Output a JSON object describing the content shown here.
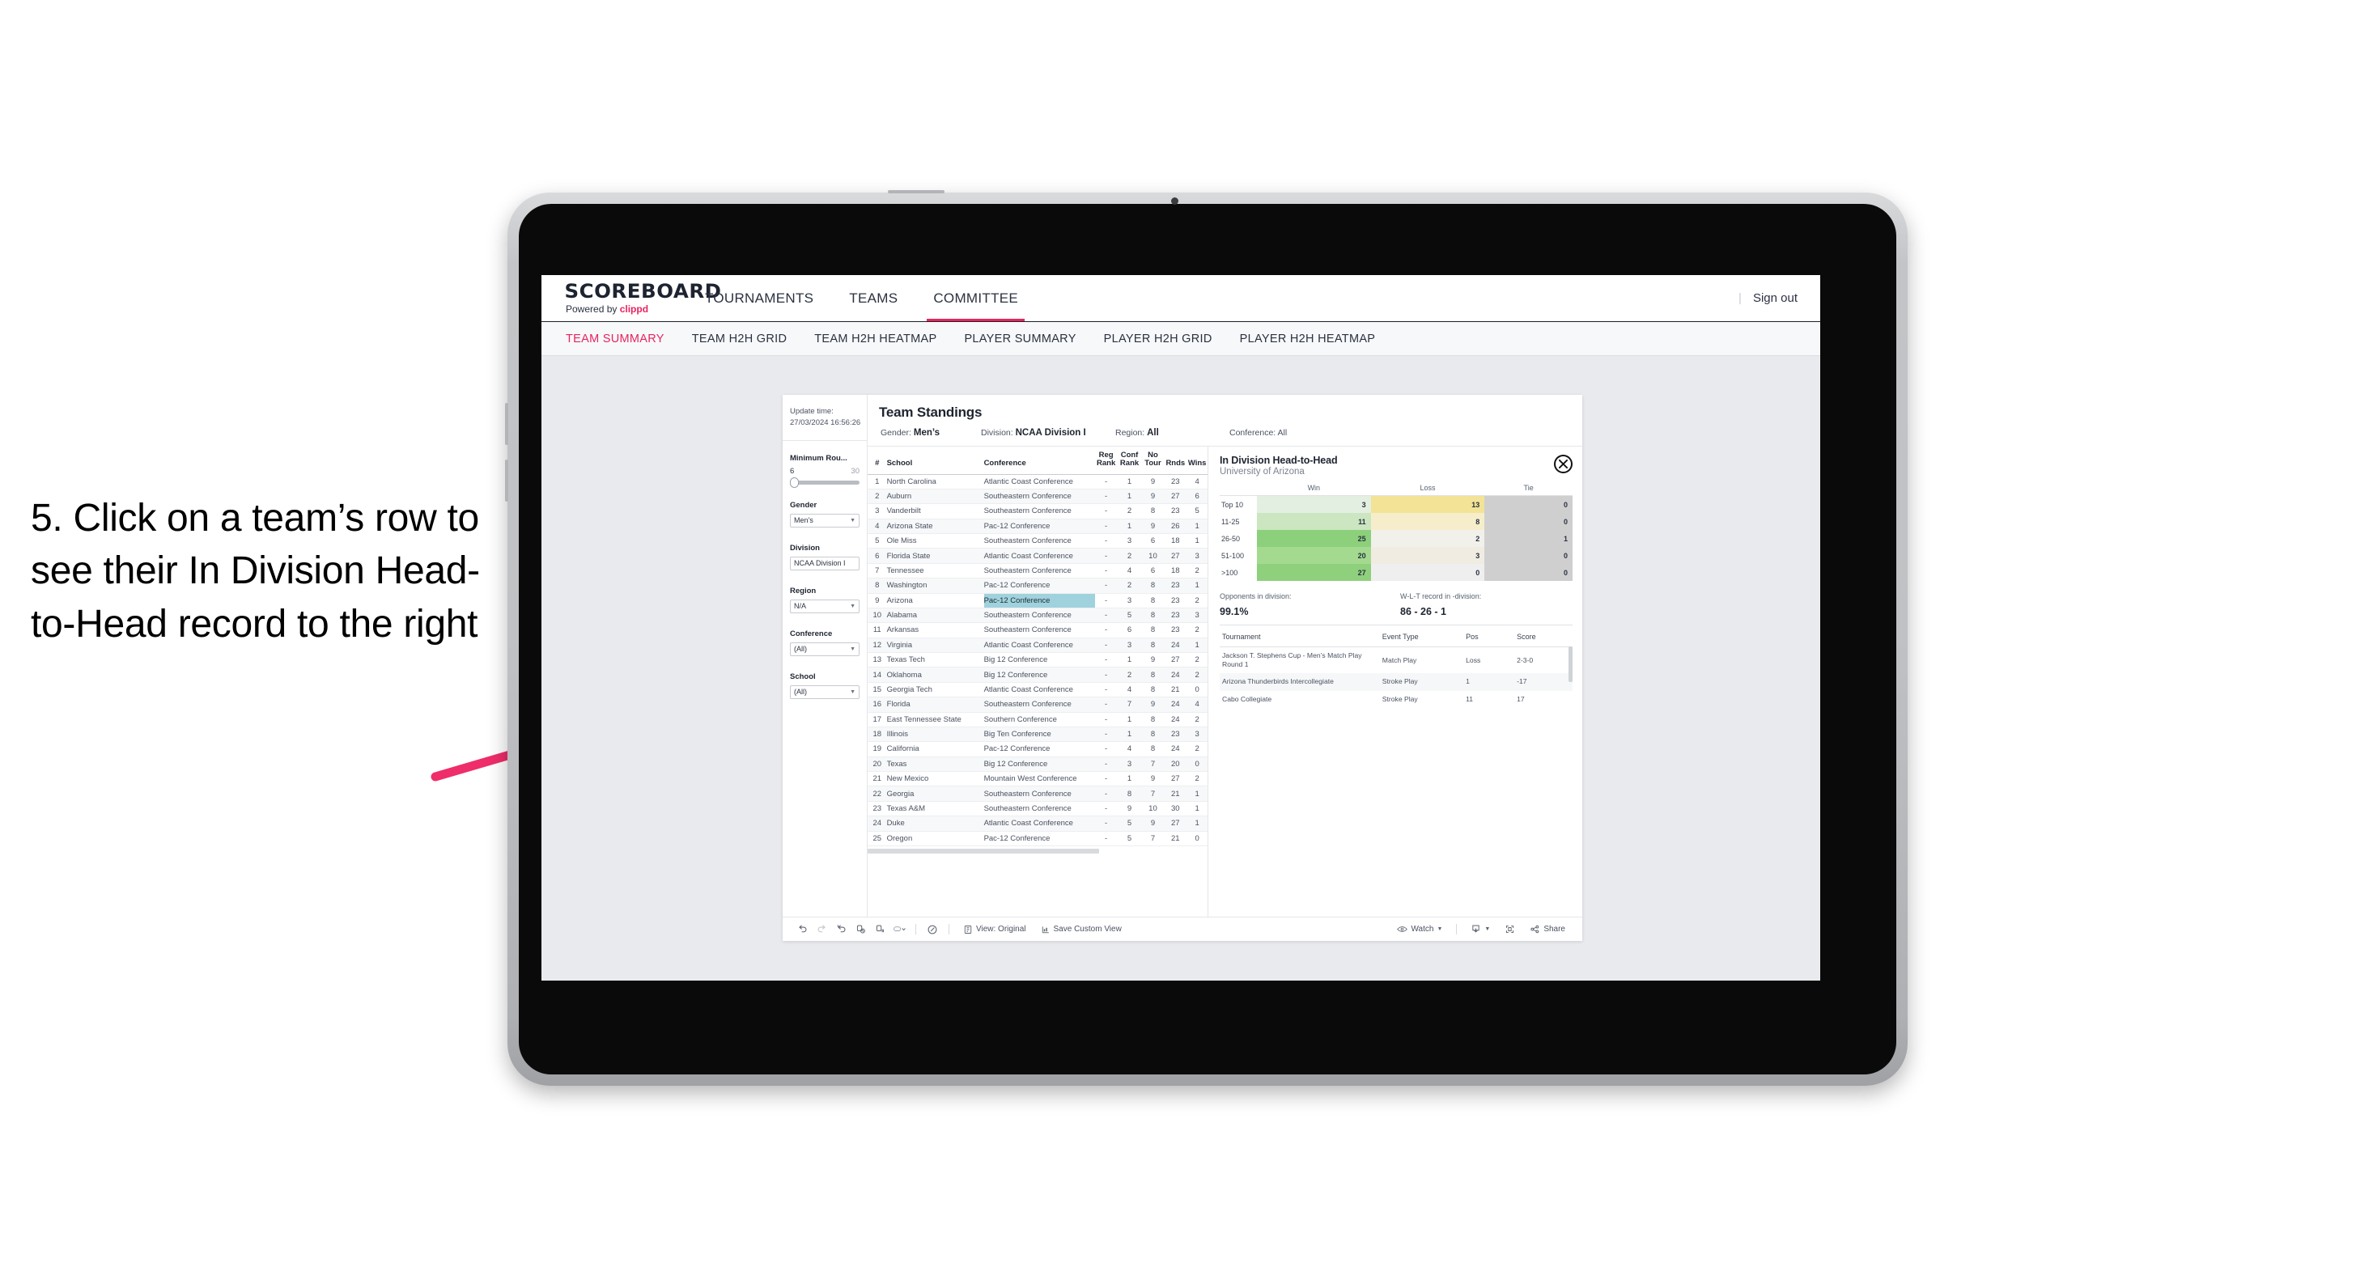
{
  "annotation": {
    "text": "5. Click on a team’s row to see their In Division Head-to-Head record to the right",
    "arrow_color": "#ef2d6a"
  },
  "app": {
    "logo": {
      "main": "SCOREBOARD",
      "powered_prefix": "Powered by ",
      "brand": "clippd"
    },
    "top_nav": [
      {
        "label": "TOURNAMENTS",
        "active": false
      },
      {
        "label": "TEAMS",
        "active": false
      },
      {
        "label": "COMMITTEE",
        "active": true
      }
    ],
    "sign_out": "Sign out",
    "sub_tabs": [
      {
        "label": "TEAM SUMMARY",
        "active": true
      },
      {
        "label": "TEAM H2H GRID",
        "active": false
      },
      {
        "label": "TEAM H2H HEATMAP",
        "active": false
      },
      {
        "label": "PLAYER SUMMARY",
        "active": false
      },
      {
        "label": "PLAYER H2H GRID",
        "active": false
      },
      {
        "label": "PLAYER H2H HEATMAP",
        "active": false
      }
    ],
    "accent_color": "#e8245e"
  },
  "filters": {
    "update_time_label": "Update time:",
    "update_time_value": "27/03/2024 16:56:26",
    "min_rounds": {
      "label": "Minimum Rou...",
      "low": "6",
      "high": "30"
    },
    "groups": [
      {
        "label": "Gender",
        "value": "Men’s"
      },
      {
        "label": "Division",
        "value": "NCAA Division I"
      },
      {
        "label": "Region",
        "value": "N/A"
      },
      {
        "label": "Conference",
        "value": "(All)"
      },
      {
        "label": "School",
        "value": "(All)"
      }
    ]
  },
  "standings": {
    "title": "Team Standings",
    "breadcrumbs": [
      {
        "key": "Gender: ",
        "value": "Men’s"
      },
      {
        "key": "Division: ",
        "value": "NCAA Division I"
      },
      {
        "key": "Region: ",
        "value": "All"
      },
      {
        "key": "Conference: ",
        "value": "All"
      }
    ],
    "columns": [
      "#",
      "School",
      "Conference",
      "Reg Rank",
      "Conf Rank",
      "No Tour",
      "Rnds",
      "Wins"
    ],
    "column_lines": [
      [
        "#"
      ],
      [
        "School"
      ],
      [
        "Conference"
      ],
      [
        "Reg",
        "Rank"
      ],
      [
        "Conf",
        "Rank"
      ],
      [
        "No",
        "Tour"
      ],
      [
        "Rnds"
      ],
      [
        "Wins"
      ]
    ],
    "selected_row_index": 8,
    "rows": [
      {
        "rank": "1",
        "school": "North Carolina",
        "conference": "Atlantic Coast Conference",
        "reg": "-",
        "conf": "1",
        "notour": "9",
        "rnds": "23",
        "wins": "4"
      },
      {
        "rank": "2",
        "school": "Auburn",
        "conference": "Southeastern Conference",
        "reg": "-",
        "conf": "1",
        "notour": "9",
        "rnds": "27",
        "wins": "6"
      },
      {
        "rank": "3",
        "school": "Vanderbilt",
        "conference": "Southeastern Conference",
        "reg": "-",
        "conf": "2",
        "notour": "8",
        "rnds": "23",
        "wins": "5"
      },
      {
        "rank": "4",
        "school": "Arizona State",
        "conference": "Pac-12 Conference",
        "reg": "-",
        "conf": "1",
        "notour": "9",
        "rnds": "26",
        "wins": "1"
      },
      {
        "rank": "5",
        "school": "Ole Miss",
        "conference": "Southeastern Conference",
        "reg": "-",
        "conf": "3",
        "notour": "6",
        "rnds": "18",
        "wins": "1"
      },
      {
        "rank": "6",
        "school": "Florida State",
        "conference": "Atlantic Coast Conference",
        "reg": "-",
        "conf": "2",
        "notour": "10",
        "rnds": "27",
        "wins": "3"
      },
      {
        "rank": "7",
        "school": "Tennessee",
        "conference": "Southeastern Conference",
        "reg": "-",
        "conf": "4",
        "notour": "6",
        "rnds": "18",
        "wins": "2"
      },
      {
        "rank": "8",
        "school": "Washington",
        "conference": "Pac-12 Conference",
        "reg": "-",
        "conf": "2",
        "notour": "8",
        "rnds": "23",
        "wins": "1"
      },
      {
        "rank": "9",
        "school": "Arizona",
        "conference": "Pac-12 Conference",
        "reg": "-",
        "conf": "3",
        "notour": "8",
        "rnds": "23",
        "wins": "2"
      },
      {
        "rank": "10",
        "school": "Alabama",
        "conference": "Southeastern Conference",
        "reg": "-",
        "conf": "5",
        "notour": "8",
        "rnds": "23",
        "wins": "3"
      },
      {
        "rank": "11",
        "school": "Arkansas",
        "conference": "Southeastern Conference",
        "reg": "-",
        "conf": "6",
        "notour": "8",
        "rnds": "23",
        "wins": "2"
      },
      {
        "rank": "12",
        "school": "Virginia",
        "conference": "Atlantic Coast Conference",
        "reg": "-",
        "conf": "3",
        "notour": "8",
        "rnds": "24",
        "wins": "1"
      },
      {
        "rank": "13",
        "school": "Texas Tech",
        "conference": "Big 12 Conference",
        "reg": "-",
        "conf": "1",
        "notour": "9",
        "rnds": "27",
        "wins": "2"
      },
      {
        "rank": "14",
        "school": "Oklahoma",
        "conference": "Big 12 Conference",
        "reg": "-",
        "conf": "2",
        "notour": "8",
        "rnds": "24",
        "wins": "2"
      },
      {
        "rank": "15",
        "school": "Georgia Tech",
        "conference": "Atlantic Coast Conference",
        "reg": "-",
        "conf": "4",
        "notour": "8",
        "rnds": "21",
        "wins": "0"
      },
      {
        "rank": "16",
        "school": "Florida",
        "conference": "Southeastern Conference",
        "reg": "-",
        "conf": "7",
        "notour": "9",
        "rnds": "24",
        "wins": "4"
      },
      {
        "rank": "17",
        "school": "East Tennessee State",
        "conference": "Southern Conference",
        "reg": "-",
        "conf": "1",
        "notour": "8",
        "rnds": "24",
        "wins": "2"
      },
      {
        "rank": "18",
        "school": "Illinois",
        "conference": "Big Ten Conference",
        "reg": "-",
        "conf": "1",
        "notour": "8",
        "rnds": "23",
        "wins": "3"
      },
      {
        "rank": "19",
        "school": "California",
        "conference": "Pac-12 Conference",
        "reg": "-",
        "conf": "4",
        "notour": "8",
        "rnds": "24",
        "wins": "2"
      },
      {
        "rank": "20",
        "school": "Texas",
        "conference": "Big 12 Conference",
        "reg": "-",
        "conf": "3",
        "notour": "7",
        "rnds": "20",
        "wins": "0"
      },
      {
        "rank": "21",
        "school": "New Mexico",
        "conference": "Mountain West Conference",
        "reg": "-",
        "conf": "1",
        "notour": "9",
        "rnds": "27",
        "wins": "2"
      },
      {
        "rank": "22",
        "school": "Georgia",
        "conference": "Southeastern Conference",
        "reg": "-",
        "conf": "8",
        "notour": "7",
        "rnds": "21",
        "wins": "1"
      },
      {
        "rank": "23",
        "school": "Texas A&M",
        "conference": "Southeastern Conference",
        "reg": "-",
        "conf": "9",
        "notour": "10",
        "rnds": "30",
        "wins": "1"
      },
      {
        "rank": "24",
        "school": "Duke",
        "conference": "Atlantic Coast Conference",
        "reg": "-",
        "conf": "5",
        "notour": "9",
        "rnds": "27",
        "wins": "1"
      },
      {
        "rank": "25",
        "school": "Oregon",
        "conference": "Pac-12 Conference",
        "reg": "-",
        "conf": "5",
        "notour": "7",
        "rnds": "21",
        "wins": "0"
      }
    ]
  },
  "h2h": {
    "title": "In Division Head-to-Head",
    "subtitle": "University of Arizona",
    "close_icon": "close-icon",
    "columns": [
      "",
      "Win",
      "Loss",
      "Tie"
    ],
    "rows": [
      {
        "bucket": "Top 10",
        "win": "3",
        "loss": "13",
        "tie": "0",
        "win_color": "#e3efe0",
        "loss_color": "#f2e396",
        "tie_color": "#cfcfcf"
      },
      {
        "bucket": "11-25",
        "win": "11",
        "loss": "8",
        "tie": "0",
        "win_color": "#cbe6c0",
        "loss_color": "#f6eecb",
        "tie_color": "#cfcfcf"
      },
      {
        "bucket": "26-50",
        "win": "25",
        "loss": "2",
        "tie": "1",
        "win_color": "#8cd07c",
        "loss_color": "#f1f0ea",
        "tie_color": "#cfcfcf"
      },
      {
        "bucket": "51-100",
        "win": "20",
        "loss": "3",
        "tie": "0",
        "win_color": "#a3da90",
        "loss_color": "#f0ece1",
        "tie_color": "#cfcfcf"
      },
      {
        "bucket": ">100",
        "win": "27",
        "loss": "0",
        "tie": "0",
        "win_color": "#8ed07c",
        "loss_color": "#efefef",
        "tie_color": "#cfcfcf"
      }
    ],
    "stats": [
      {
        "key": "Opponents in division:",
        "value": "99.1%"
      },
      {
        "key": "W-L-T record in -division:",
        "value": "86 - 26 - 1"
      }
    ],
    "tournaments": {
      "columns": [
        "Tournament",
        "Event Type",
        "Pos",
        "Score"
      ],
      "rows": [
        {
          "name": "Jackson T. Stephens Cup - Men’s Match Play Round 1",
          "type": "Match Play",
          "pos": "Loss",
          "score": "2-3-0"
        },
        {
          "name": "Arizona Thunderbirds Intercollegiate",
          "type": "Stroke Play",
          "pos": "1",
          "score": "-17"
        },
        {
          "name": "Cabo Collegiate",
          "type": "Stroke Play",
          "pos": "11",
          "score": "17"
        }
      ]
    }
  },
  "toolbar": {
    "icons": [
      "undo-icon",
      "redo-icon",
      "revert-icon",
      "refresh-data-icon",
      "pause-icon",
      "device-layout-icon"
    ],
    "alert_icon": "alerts-icon",
    "view_label": "View: Original",
    "view_icon": "view-icon",
    "save_label": "Save Custom View",
    "save_icon": "save-view-icon",
    "watch_label": "Watch",
    "watch_icon": "eye-icon",
    "download_icon": "download-icon",
    "fullscreen_icon": "fullscreen-icon",
    "share_label": "Share",
    "share_icon": "share-icon"
  }
}
